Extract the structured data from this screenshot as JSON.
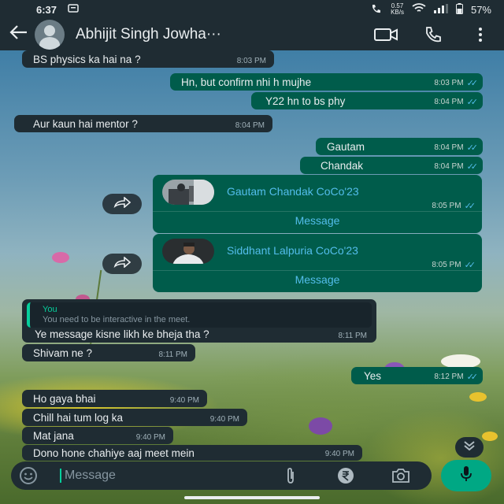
{
  "status_bar": {
    "time": "6:37",
    "network_speed_value": "0.57",
    "network_speed_unit": "KB/s",
    "battery": "57%"
  },
  "header": {
    "contact_name": "Abhijit Singh Jowha···"
  },
  "messages": [
    {
      "direction": "in",
      "text": "BS physics ka hai na ?",
      "time": "8:03 PM"
    },
    {
      "direction": "out",
      "text": "Hn, but confirm nhi h mujhe",
      "time": "8:03 PM",
      "read": true
    },
    {
      "direction": "out",
      "text": "Y22 hn to bs phy",
      "time": "8:04 PM",
      "read": true
    },
    {
      "direction": "in",
      "text": "Aur kaun hai mentor ?",
      "time": "8:04 PM"
    },
    {
      "direction": "out",
      "text": "Gautam",
      "time": "8:04 PM",
      "read": true
    },
    {
      "direction": "out",
      "text": "Chandak",
      "time": "8:04 PM",
      "read": true
    },
    {
      "direction": "in",
      "text": "Shivam ne ?",
      "time": "8:11 PM"
    },
    {
      "direction": "out",
      "text": "Yes",
      "time": "8:12 PM",
      "read": true
    },
    {
      "direction": "in",
      "text": "Ho gaya bhai",
      "time": "9:40 PM"
    },
    {
      "direction": "in",
      "text": "Chill hai tum log ka",
      "time": "9:40 PM"
    },
    {
      "direction": "in",
      "text": "Mat jana",
      "time": "9:40 PM"
    },
    {
      "direction": "in",
      "text": "Dono hone chahiye aaj meet mein",
      "time": "9:40 PM"
    }
  ],
  "contact_cards": [
    {
      "name": "Gautam Chandak CoCo'23",
      "time": "8:05 PM",
      "action": "Message",
      "read": true
    },
    {
      "name": "Siddhant Lalpuria CoCo'23",
      "time": "8:05 PM",
      "action": "Message",
      "read": true
    }
  ],
  "reply_message": {
    "quoted_author": "You",
    "quoted_text": "You need to be interactive in the meet.",
    "text": "Ye message kisne likh ke bheja tha ?",
    "time": "8:11 PM"
  },
  "composer": {
    "placeholder": "Message"
  },
  "icons": {
    "back": "arrow-left-icon",
    "video_call": "video-camera-icon",
    "voice_call": "phone-icon",
    "menu": "more-vertical-icon",
    "emoji": "emoji-icon",
    "attach": "paperclip-icon",
    "payment": "rupee-icon",
    "camera": "camera-icon",
    "mic": "microphone-icon",
    "forward": "forward-icon",
    "scroll_down": "double-chevron-down-icon"
  },
  "colors": {
    "incoming_bubble": "#1f2c33",
    "outgoing_bubble": "#005c4b",
    "accent": "#00a884",
    "link_blue": "#53bdeb",
    "header_bg": "#1f2c33"
  }
}
